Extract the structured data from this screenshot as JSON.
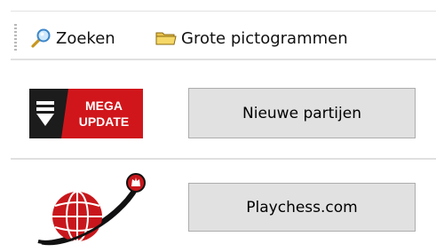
{
  "toolbar": {
    "search_label": "Zoeken",
    "search_icon": "search-icon",
    "large_icons_label": "Grote pictogrammen",
    "large_icons_icon": "folder-icon"
  },
  "rows": [
    {
      "logo_lines": [
        "MEGA",
        "UPDATE"
      ],
      "logo_icon": "mega-update-logo",
      "button_label": "Nieuwe partijen"
    },
    {
      "logo_icon": "playchess-globe-logo",
      "button_label": "Playchess.com"
    }
  ],
  "colors": {
    "mega_red": "#d0161b",
    "mega_dark": "#1c1c1c",
    "globe_red": "#c8171c",
    "button_bg": "#e1e1e1",
    "button_border": "#adadad"
  }
}
